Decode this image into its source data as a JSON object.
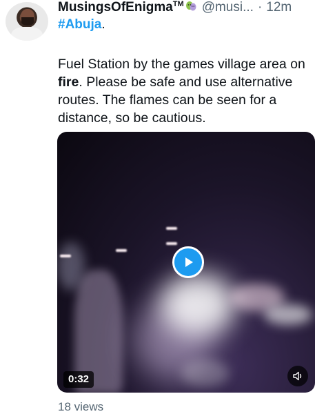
{
  "tweet": {
    "author_name": "MusingsOfEnigma",
    "tm_mark": "TM",
    "handle": "@musi...",
    "separator": "·",
    "time": "12m",
    "hashtag": "#Abuja",
    "hashtag_suffix": ".",
    "text_part1": "Fuel Station by the games village area on ",
    "text_bold": "fire",
    "text_part2": ". Please be safe and use alternative routes. The flames can be seen for a distance, so be cautious.",
    "badge_icon": "theater-masks-icon"
  },
  "video": {
    "duration": "0:32",
    "play_icon": "play-icon",
    "mute_icon": "speaker-muted-icon",
    "accent_color": "#1d9bf0"
  },
  "views": "18 views"
}
